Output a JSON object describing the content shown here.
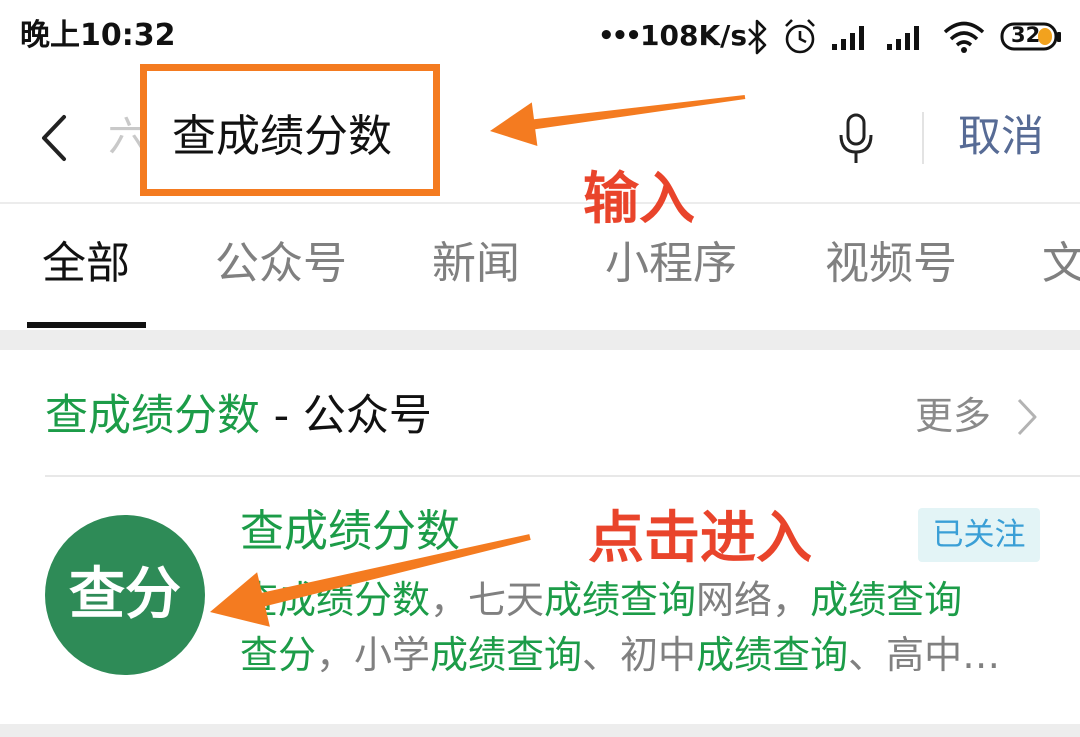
{
  "status_bar": {
    "time": "晚上10:32",
    "dots": "•••",
    "net_speed": "108K/s",
    "battery": "32",
    "icons": [
      "bluetooth-icon",
      "alarm-icon",
      "signal-icon",
      "signal-icon",
      "wifi-icon",
      "battery-icon"
    ]
  },
  "search": {
    "faded_char": "六",
    "query": "查成绩分数",
    "cancel_label": "取消",
    "icons": [
      "back-icon",
      "microphone-icon"
    ]
  },
  "annotations": {
    "input_hint": "输入",
    "click_hint": "点击进入"
  },
  "tabs": [
    {
      "label": "全部",
      "active": true
    },
    {
      "label": "公众号",
      "active": false
    },
    {
      "label": "新闻",
      "active": false
    },
    {
      "label": "小程序",
      "active": false
    },
    {
      "label": "视频号",
      "active": false
    },
    {
      "label": "文",
      "active": false
    }
  ],
  "section": {
    "title_keyword": "查成绩分数",
    "title_suffix": " - 公众号",
    "more_label": "更多",
    "more_icon": "chevron-right-icon"
  },
  "result": {
    "avatar_text": "查分",
    "name": "查成绩分数",
    "badge": "已关注",
    "description": [
      [
        {
          "text": "查成绩分数",
          "highlight": true
        },
        {
          "text": "，七天",
          "highlight": false
        },
        {
          "text": "成绩查询",
          "highlight": true
        },
        {
          "text": "网络，",
          "highlight": false
        },
        {
          "text": "成绩查询",
          "highlight": true
        }
      ],
      [
        {
          "text": "查分",
          "highlight": true
        },
        {
          "text": "，小学",
          "highlight": false
        },
        {
          "text": "成绩查询",
          "highlight": true
        },
        {
          "text": "、初中",
          "highlight": false
        },
        {
          "text": "成绩查询",
          "highlight": true
        },
        {
          "text": "、高中…",
          "highlight": false
        }
      ]
    ]
  },
  "colors": {
    "highlight_green": "#1c9c48",
    "avatar": "#2e8b57",
    "link_blue": "#576b95",
    "badge_bg": "#e3f4f6",
    "badge_text": "#3a9fd6",
    "annotation_arrow": "#f47b20",
    "annotation_text": "#e9442b"
  }
}
